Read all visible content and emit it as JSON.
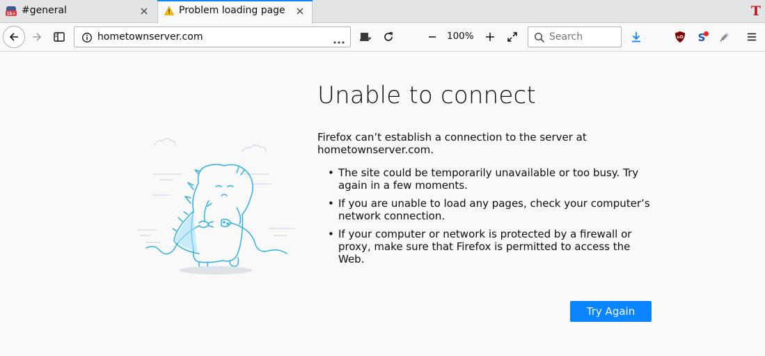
{
  "tabs": [
    {
      "label": "#general",
      "favicon": "chat-app-icon",
      "active": false
    },
    {
      "label": "Problem loading page",
      "favicon": "warning-icon",
      "active": true
    }
  ],
  "toolbar": {
    "url": "hometownserver.com",
    "zoom_level": "100%",
    "search_placeholder": "Search",
    "extension_t_label": "T",
    "chat_badge": "1k+"
  },
  "error": {
    "title": "Unable to connect",
    "description": "Firefox can’t establish a connection to the server at hometownserver.com.",
    "reasons": [
      "The site could be temporarily unavailable or too busy. Try again in a few moments.",
      "If you are unable to load any pages, check your computer’s network connection.",
      "If your computer or network is protected by a firewall or proxy, make sure that Firefox is permitted to access the Web."
    ],
    "button_label": "Try Again"
  },
  "colors": {
    "accent": "#0a84ff",
    "warning": "#d7b600",
    "illustration": "#2eb0e8"
  }
}
